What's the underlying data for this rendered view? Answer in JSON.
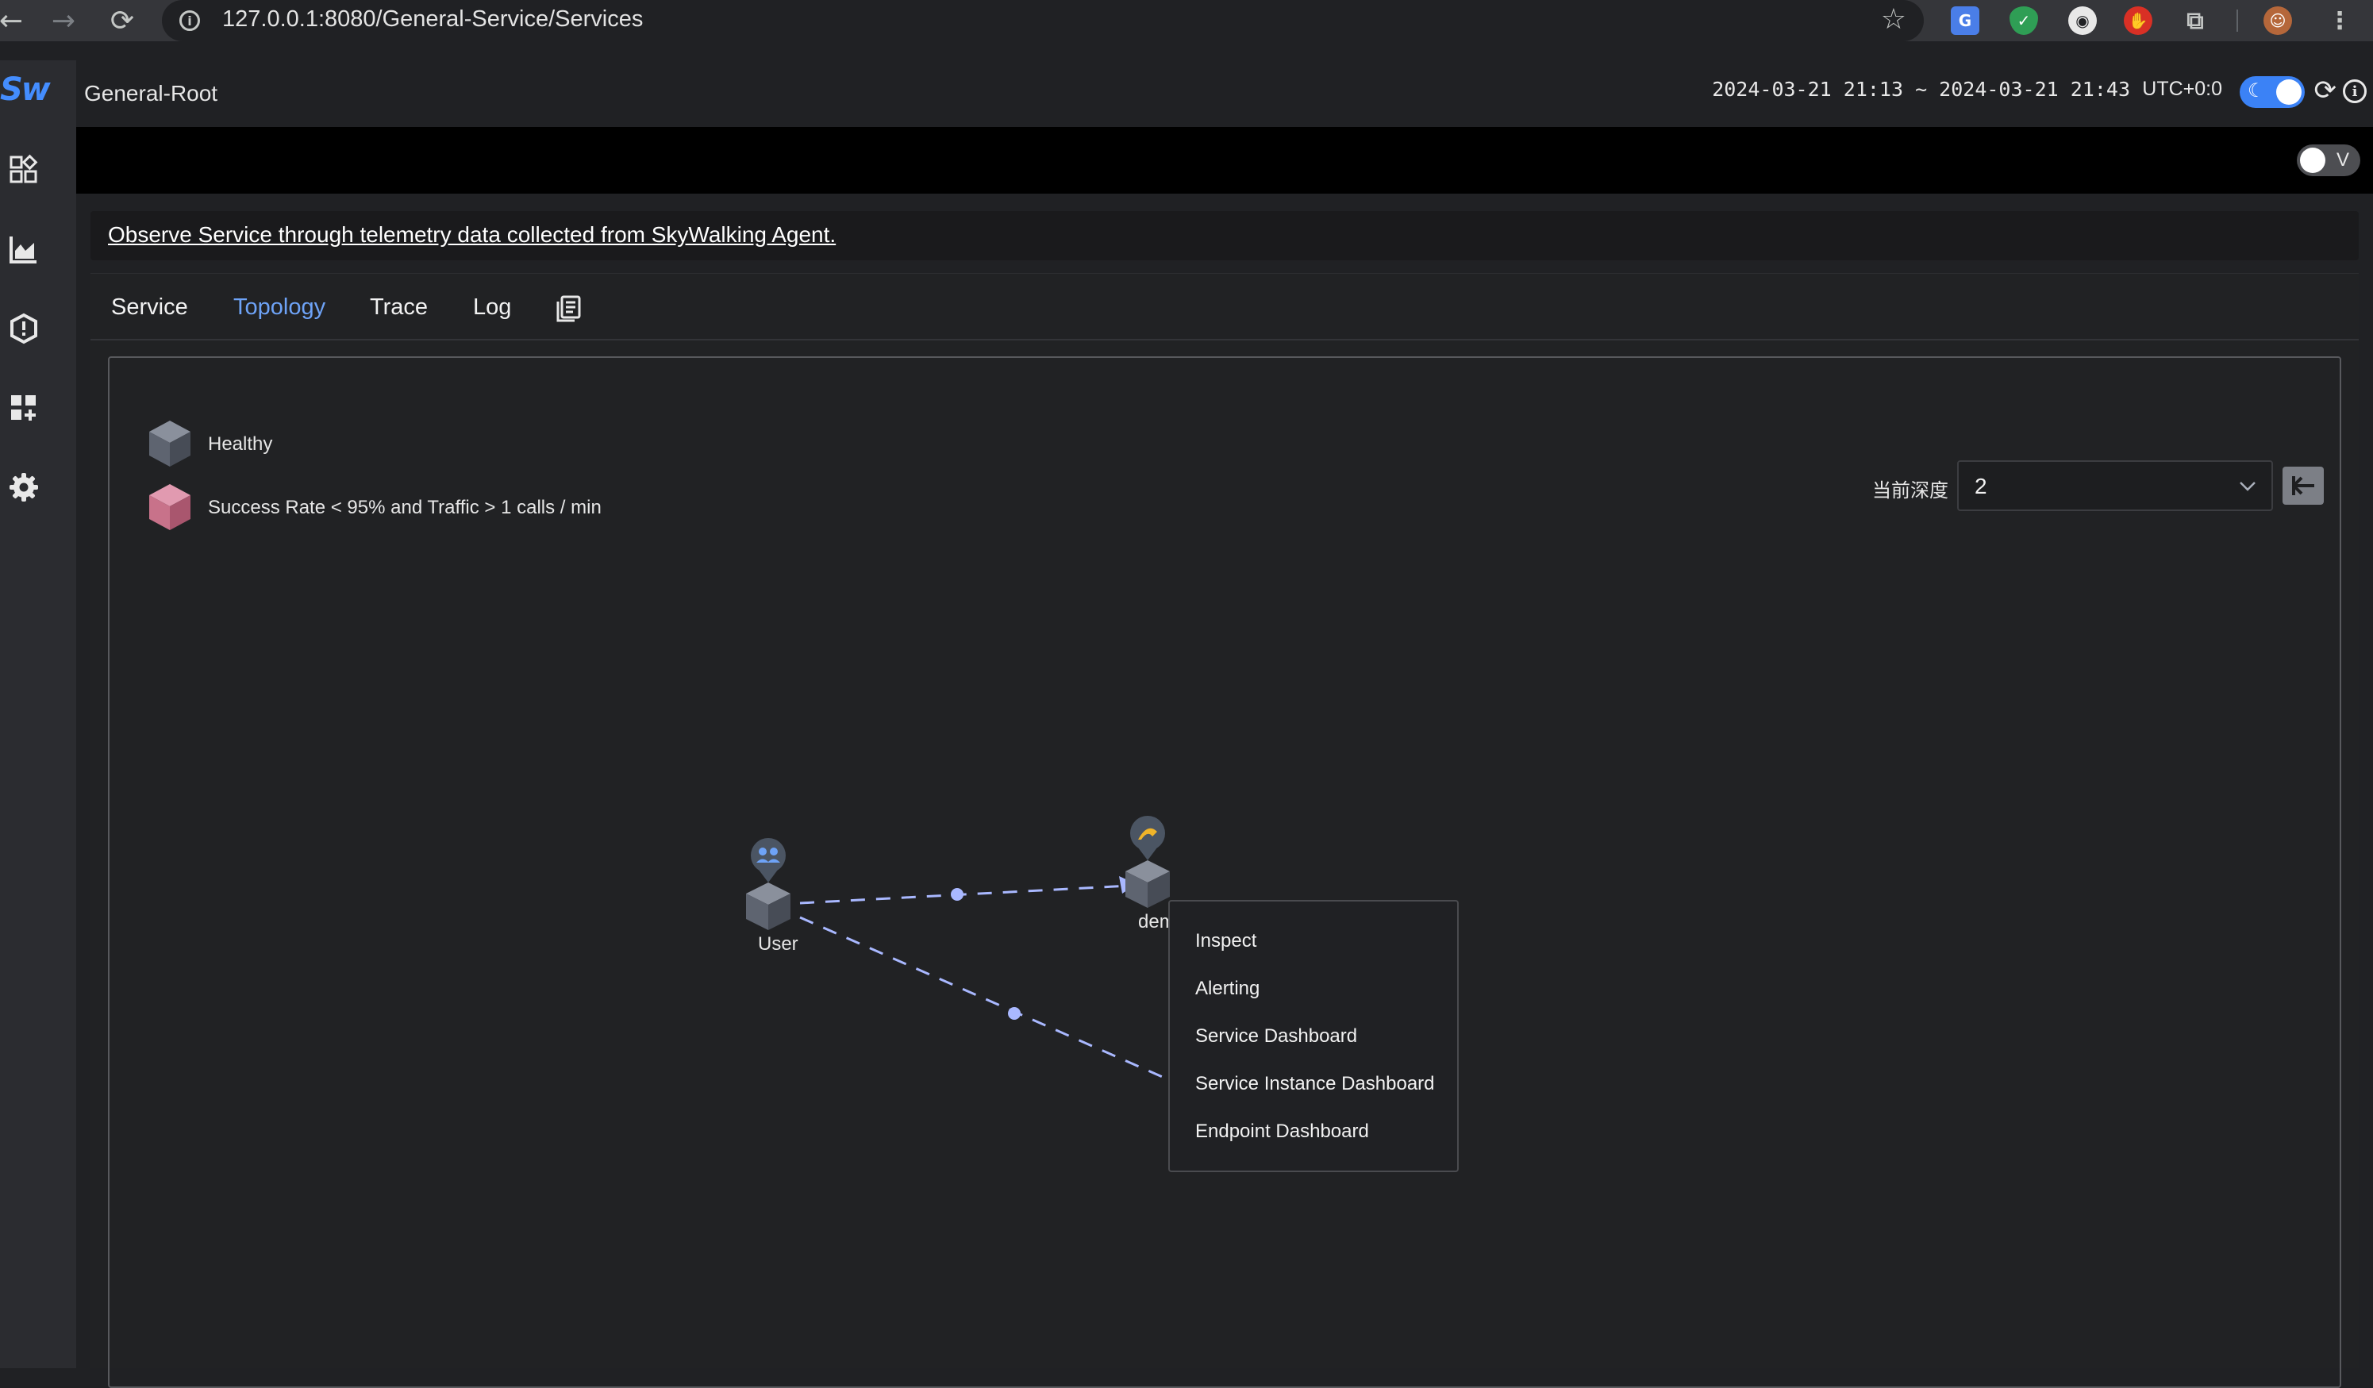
{
  "browser": {
    "url": "127.0.0.1:8080/General-Service/Services",
    "back_icon": "arrow-left",
    "forward_icon": "arrow-right",
    "reload_icon": "reload",
    "bookmark_icon": "star-outline",
    "extension_icons": [
      "translate",
      "shield-check",
      "incognito-face",
      "stop-hand",
      "puzzle-piece",
      "avatar",
      "kebab-menu"
    ]
  },
  "app": {
    "logo": "Sw",
    "header_title": "General-Root",
    "time_range": "2024-03-21 21:13 ~ 2024-03-21 21:43",
    "timezone": "UTC+0:0",
    "version_toggle_label": "V",
    "sidebar_icons": [
      "dashboard-widgets",
      "chart-area",
      "alert-shield",
      "add-widget-grid",
      "settings-gear"
    ]
  },
  "description": {
    "text": "Observe Service through telemetry data collected from SkyWalking Agent."
  },
  "tabs": [
    {
      "label": "Service",
      "active": false
    },
    {
      "label": "Topology",
      "active": true
    },
    {
      "label": "Trace",
      "active": false
    },
    {
      "label": "Log",
      "active": false
    }
  ],
  "legend": {
    "healthy": "Healthy",
    "unhealthy": "Success Rate < 95% and Traffic > 1 calls / min"
  },
  "depth": {
    "label": "当前深度",
    "value": "2"
  },
  "topology": {
    "nodes": [
      {
        "name": "User",
        "type": "user"
      },
      {
        "name": "dem",
        "type": "service"
      }
    ]
  },
  "context_menu": {
    "items": [
      "Inspect",
      "Alerting",
      "Service Dashboard",
      "Service Instance Dashboard",
      "Endpoint Dashboard"
    ]
  },
  "colors": {
    "accent": "#6ea3f7",
    "healthy_node": "#5e6470",
    "unhealthy_node": "#c8728a",
    "edge": "#a9b8ff"
  }
}
